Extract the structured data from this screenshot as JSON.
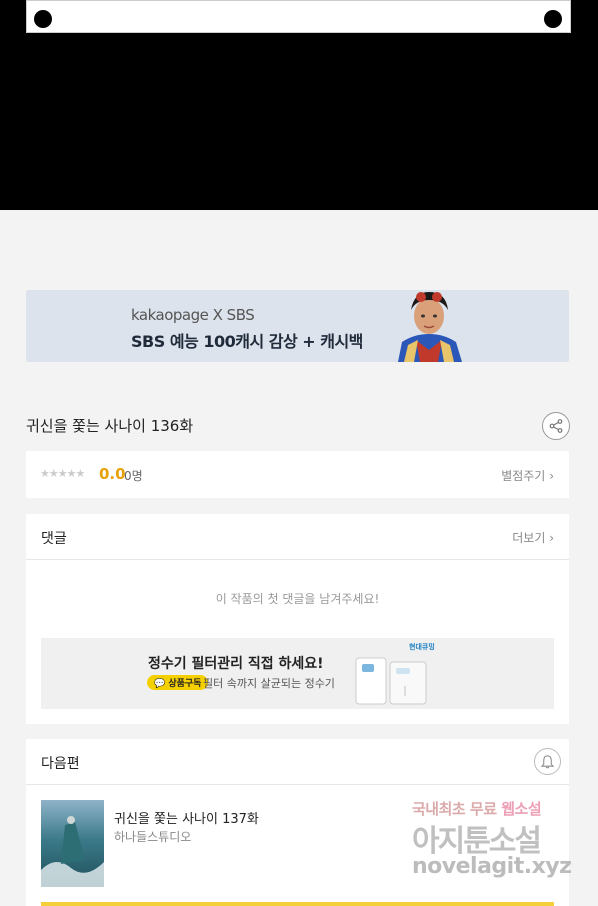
{
  "banner": {
    "brand": "kakaopage X SBS",
    "promo": "SBS 예능 100캐시 감상 + 캐시백"
  },
  "episode": {
    "title": "귀신을 쫓는 사나이 136화"
  },
  "rating": {
    "stars": "★★★★★",
    "score": "0.0",
    "count": "0명",
    "rate_label": "별점주기"
  },
  "comments": {
    "title": "댓글",
    "more_label": "더보기",
    "empty_message": "이 작품의 첫 댓글을 남겨주세요!",
    "ad": {
      "title": "정수기 필터관리 직접 하세요!",
      "badge": "상품구독",
      "subtitle": "필터 속까지 살균되는 정수기",
      "logo": "현대큐밍"
    }
  },
  "next_episode": {
    "section_title": "다음편",
    "title": "귀신을 쫓는 사나이 137화",
    "author": "하나들스튜디오"
  },
  "watermark": {
    "line1_a": "국내최초 무료 ",
    "line1_b": "웹소설",
    "line2": "아지툰소설",
    "line3": "novelagit.xyz"
  }
}
